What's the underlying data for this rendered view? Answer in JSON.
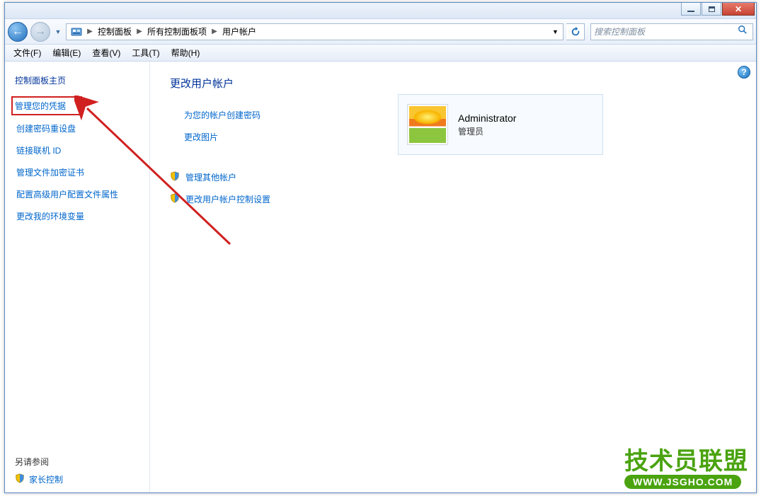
{
  "titlebar": {},
  "breadcrumb": {
    "seg1": "控制面板",
    "seg2": "所有控制面板项",
    "seg3": "用户帐户"
  },
  "search": {
    "placeholder": "搜索控制面板"
  },
  "menu": {
    "file": "文件(F)",
    "edit": "编辑(E)",
    "view": "查看(V)",
    "tools": "工具(T)",
    "help": "帮助(H)"
  },
  "sidebar": {
    "home_title": "控制面板主页",
    "links": {
      "manage_credentials": "管理您的凭据",
      "create_reset_disk": "创建密码重设盘",
      "link_online_id": "链接联机 ID",
      "manage_efs_cert": "管理文件加密证书",
      "configure_profile": "配置高级用户配置文件属性",
      "change_env_vars": "更改我的环境变量"
    },
    "see_also_title": "另请参阅",
    "see_also_link": "家长控制"
  },
  "main": {
    "title": "更改用户帐户",
    "actions": {
      "create_password": "为您的帐户创建密码",
      "change_picture": "更改图片",
      "manage_other_accounts": "管理其他帐户",
      "change_uac_settings": "更改用户帐户控制设置"
    }
  },
  "account": {
    "name": "Administrator",
    "role": "管理员"
  },
  "watermark": {
    "top": "技术员联盟",
    "bottom": "WWW.JSGHO.COM"
  },
  "help_glyph": "?"
}
